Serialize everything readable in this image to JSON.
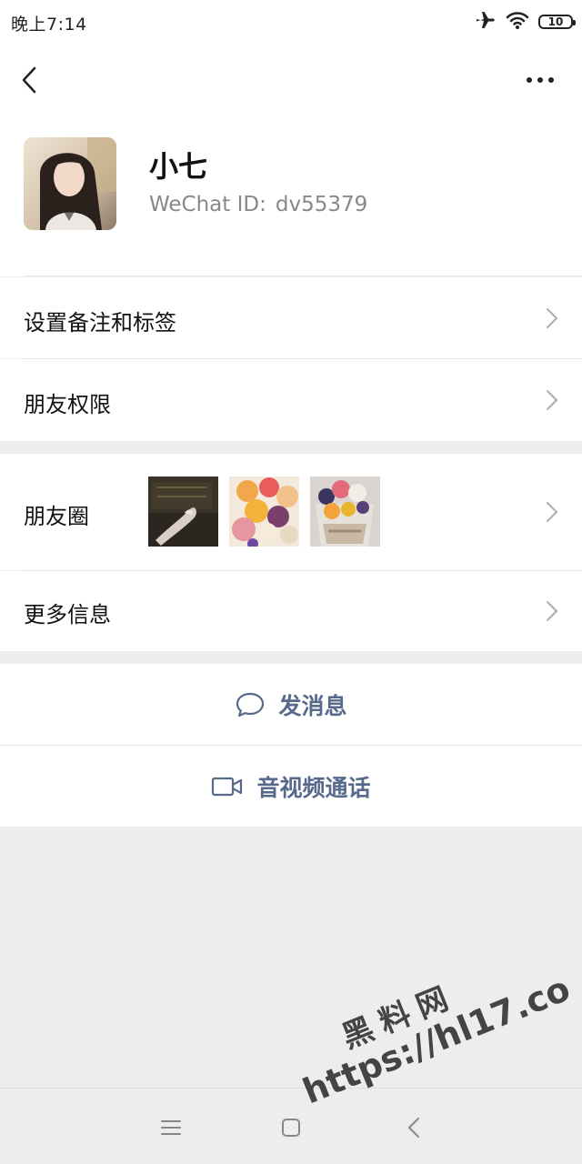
{
  "status_bar": {
    "time": "晚上7:14",
    "battery": "10"
  },
  "header": {
    "back_icon": "chevron-left-icon",
    "more_icon": "more-dots-icon"
  },
  "profile": {
    "name": "小七",
    "wechat_id_label": "WeChat ID:",
    "wechat_id_value": "dv55379"
  },
  "menu": {
    "remarks_tags": "设置备注和标签",
    "friend_permissions": "朋友权限",
    "moments": "朋友圈",
    "more_info": "更多信息"
  },
  "actions": {
    "send_message": "发消息",
    "video_call": "音视频通话"
  },
  "watermark": {
    "line1": "黑料网",
    "line2": "https://hl17.co"
  },
  "colors": {
    "action_text": "#586a8c",
    "background": "#ededed",
    "card": "#ffffff"
  }
}
